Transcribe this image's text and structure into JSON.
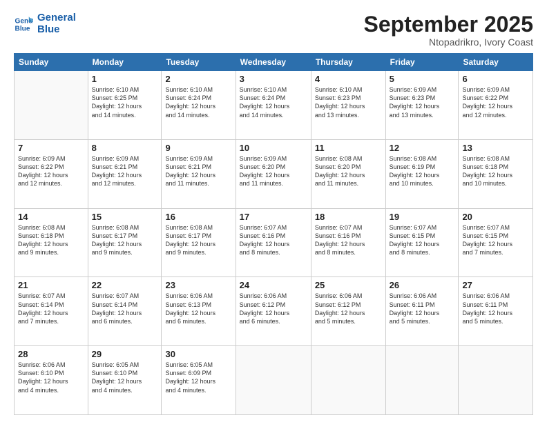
{
  "logo": {
    "line1": "General",
    "line2": "Blue"
  },
  "title": "September 2025",
  "location": "Ntopadrikro, Ivory Coast",
  "days_of_week": [
    "Sunday",
    "Monday",
    "Tuesday",
    "Wednesday",
    "Thursday",
    "Friday",
    "Saturday"
  ],
  "weeks": [
    [
      {
        "day": "",
        "info": ""
      },
      {
        "day": "1",
        "info": "Sunrise: 6:10 AM\nSunset: 6:25 PM\nDaylight: 12 hours\nand 14 minutes."
      },
      {
        "day": "2",
        "info": "Sunrise: 6:10 AM\nSunset: 6:24 PM\nDaylight: 12 hours\nand 14 minutes."
      },
      {
        "day": "3",
        "info": "Sunrise: 6:10 AM\nSunset: 6:24 PM\nDaylight: 12 hours\nand 14 minutes."
      },
      {
        "day": "4",
        "info": "Sunrise: 6:10 AM\nSunset: 6:23 PM\nDaylight: 12 hours\nand 13 minutes."
      },
      {
        "day": "5",
        "info": "Sunrise: 6:09 AM\nSunset: 6:23 PM\nDaylight: 12 hours\nand 13 minutes."
      },
      {
        "day": "6",
        "info": "Sunrise: 6:09 AM\nSunset: 6:22 PM\nDaylight: 12 hours\nand 12 minutes."
      }
    ],
    [
      {
        "day": "7",
        "info": "Sunrise: 6:09 AM\nSunset: 6:22 PM\nDaylight: 12 hours\nand 12 minutes."
      },
      {
        "day": "8",
        "info": "Sunrise: 6:09 AM\nSunset: 6:21 PM\nDaylight: 12 hours\nand 12 minutes."
      },
      {
        "day": "9",
        "info": "Sunrise: 6:09 AM\nSunset: 6:21 PM\nDaylight: 12 hours\nand 11 minutes."
      },
      {
        "day": "10",
        "info": "Sunrise: 6:09 AM\nSunset: 6:20 PM\nDaylight: 12 hours\nand 11 minutes."
      },
      {
        "day": "11",
        "info": "Sunrise: 6:08 AM\nSunset: 6:20 PM\nDaylight: 12 hours\nand 11 minutes."
      },
      {
        "day": "12",
        "info": "Sunrise: 6:08 AM\nSunset: 6:19 PM\nDaylight: 12 hours\nand 10 minutes."
      },
      {
        "day": "13",
        "info": "Sunrise: 6:08 AM\nSunset: 6:18 PM\nDaylight: 12 hours\nand 10 minutes."
      }
    ],
    [
      {
        "day": "14",
        "info": "Sunrise: 6:08 AM\nSunset: 6:18 PM\nDaylight: 12 hours\nand 9 minutes."
      },
      {
        "day": "15",
        "info": "Sunrise: 6:08 AM\nSunset: 6:17 PM\nDaylight: 12 hours\nand 9 minutes."
      },
      {
        "day": "16",
        "info": "Sunrise: 6:08 AM\nSunset: 6:17 PM\nDaylight: 12 hours\nand 9 minutes."
      },
      {
        "day": "17",
        "info": "Sunrise: 6:07 AM\nSunset: 6:16 PM\nDaylight: 12 hours\nand 8 minutes."
      },
      {
        "day": "18",
        "info": "Sunrise: 6:07 AM\nSunset: 6:16 PM\nDaylight: 12 hours\nand 8 minutes."
      },
      {
        "day": "19",
        "info": "Sunrise: 6:07 AM\nSunset: 6:15 PM\nDaylight: 12 hours\nand 8 minutes."
      },
      {
        "day": "20",
        "info": "Sunrise: 6:07 AM\nSunset: 6:15 PM\nDaylight: 12 hours\nand 7 minutes."
      }
    ],
    [
      {
        "day": "21",
        "info": "Sunrise: 6:07 AM\nSunset: 6:14 PM\nDaylight: 12 hours\nand 7 minutes."
      },
      {
        "day": "22",
        "info": "Sunrise: 6:07 AM\nSunset: 6:14 PM\nDaylight: 12 hours\nand 6 minutes."
      },
      {
        "day": "23",
        "info": "Sunrise: 6:06 AM\nSunset: 6:13 PM\nDaylight: 12 hours\nand 6 minutes."
      },
      {
        "day": "24",
        "info": "Sunrise: 6:06 AM\nSunset: 6:12 PM\nDaylight: 12 hours\nand 6 minutes."
      },
      {
        "day": "25",
        "info": "Sunrise: 6:06 AM\nSunset: 6:12 PM\nDaylight: 12 hours\nand 5 minutes."
      },
      {
        "day": "26",
        "info": "Sunrise: 6:06 AM\nSunset: 6:11 PM\nDaylight: 12 hours\nand 5 minutes."
      },
      {
        "day": "27",
        "info": "Sunrise: 6:06 AM\nSunset: 6:11 PM\nDaylight: 12 hours\nand 5 minutes."
      }
    ],
    [
      {
        "day": "28",
        "info": "Sunrise: 6:06 AM\nSunset: 6:10 PM\nDaylight: 12 hours\nand 4 minutes."
      },
      {
        "day": "29",
        "info": "Sunrise: 6:05 AM\nSunset: 6:10 PM\nDaylight: 12 hours\nand 4 minutes."
      },
      {
        "day": "30",
        "info": "Sunrise: 6:05 AM\nSunset: 6:09 PM\nDaylight: 12 hours\nand 4 minutes."
      },
      {
        "day": "",
        "info": ""
      },
      {
        "day": "",
        "info": ""
      },
      {
        "day": "",
        "info": ""
      },
      {
        "day": "",
        "info": ""
      }
    ]
  ]
}
